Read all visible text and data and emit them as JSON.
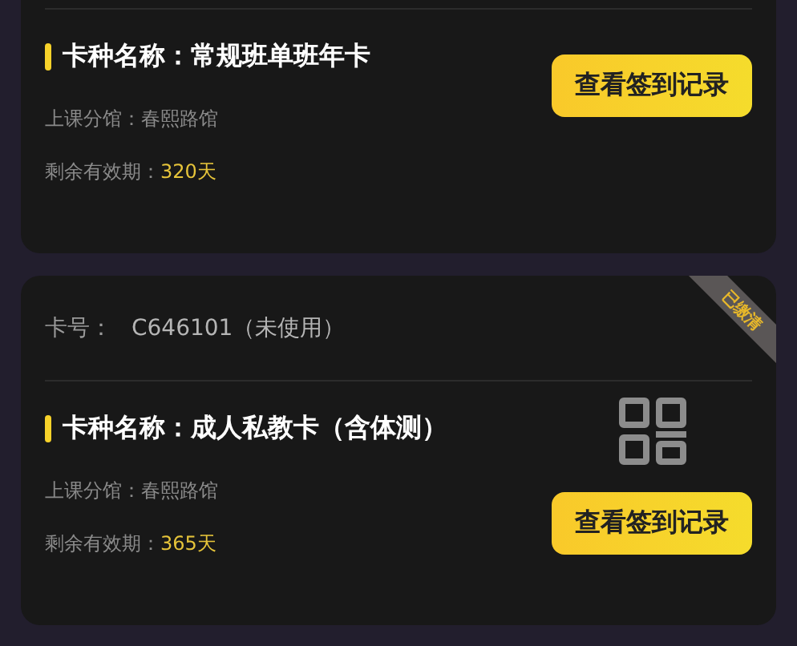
{
  "cards": [
    {
      "title": "卡种名称：常规班单班年卡",
      "branch_label": "上课分馆：",
      "branch": "春熙路馆",
      "validity_label": "剩余有效期：",
      "validity": "320天",
      "button": "查看签到记录"
    },
    {
      "card_number_label": "卡号：",
      "card_number": "C646101（未使用）",
      "badge": "已缴清",
      "title": "卡种名称：成人私教卡（含体测）",
      "branch_label": "上课分馆：",
      "branch": "春熙路馆",
      "validity_label": "剩余有效期：",
      "validity": "365天",
      "show_qr": true,
      "button": "查看签到记录"
    }
  ]
}
